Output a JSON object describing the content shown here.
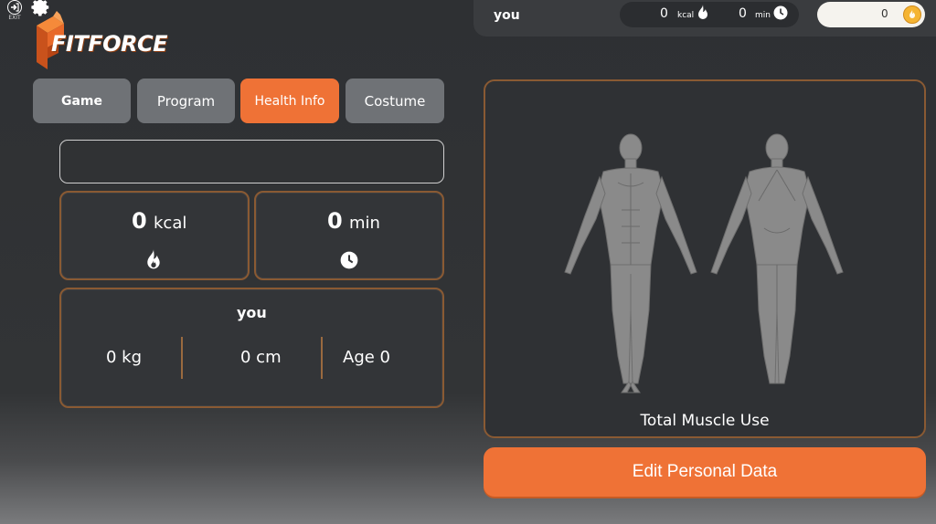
{
  "app": {
    "logo_text": "FITFORCE",
    "exit_label": "EXIT"
  },
  "topbar": {
    "user": "you",
    "kcal_value": "0",
    "kcal_unit": "kcal",
    "min_value": "0",
    "min_unit": "min",
    "coins": "0"
  },
  "tabs": [
    {
      "label": "Game"
    },
    {
      "label": "Program"
    },
    {
      "label": "Health Info",
      "active": true
    },
    {
      "label": "Costume"
    }
  ],
  "stats": {
    "kcal_value": "0",
    "kcal_unit": "kcal",
    "min_value": "0",
    "min_unit": "min"
  },
  "body": {
    "name": "you",
    "weight": "0 kg",
    "height": "0 cm",
    "age": "Age 0"
  },
  "muscle": {
    "label": "Total Muscle Use"
  },
  "actions": {
    "edit_label": "Edit Personal Data"
  },
  "colors": {
    "accent": "#ef7236",
    "border": "#8a5a33",
    "tab_inactive": "#6f7276"
  },
  "icons": [
    "exit-icon",
    "gear-icon",
    "flame-icon",
    "clock-icon",
    "coin-icon"
  ]
}
